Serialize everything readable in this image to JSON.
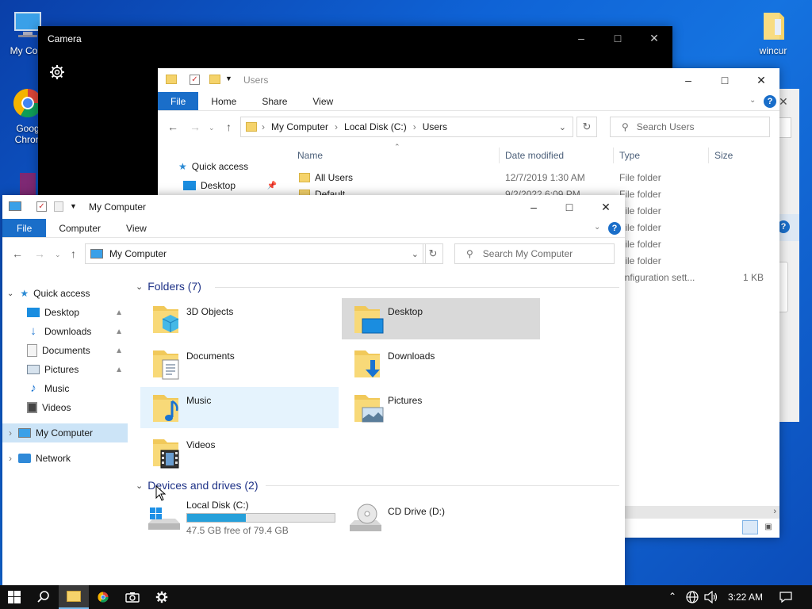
{
  "desktop": {
    "icons": [
      {
        "label": "My Com"
      },
      {
        "label": "Goog Chron"
      },
      {
        "label": "wincur"
      }
    ]
  },
  "camera": {
    "title": "Camera"
  },
  "users_window": {
    "quick_title": "Users",
    "tabs": [
      "File",
      "Home",
      "Share",
      "View"
    ],
    "breadcrumb": [
      "My Computer",
      "Local Disk (C:)",
      "Users"
    ],
    "search_placeholder": "Search Users",
    "columns": [
      "Name",
      "Date modified",
      "Type",
      "Size"
    ],
    "nav": [
      {
        "label": "Quick access"
      },
      {
        "label": "Desktop"
      }
    ],
    "rows": [
      {
        "name": "All Users",
        "date": "12/7/2019 1:30 AM",
        "type": "File folder",
        "size": ""
      },
      {
        "name": "Default",
        "date": "9/2/2022 6:09 PM",
        "type": "File folder",
        "size": ""
      },
      {
        "name": "",
        "date": "",
        "type": "File folder",
        "size": ""
      },
      {
        "name": "",
        "date": "",
        "type": "File folder",
        "size": ""
      },
      {
        "name": "",
        "date": "",
        "type": "File folder",
        "size": ""
      },
      {
        "name": "",
        "date": "",
        "type": "File folder",
        "size": ""
      },
      {
        "name": "",
        "date": "",
        "type": "onfiguration sett...",
        "size": "1 KB"
      }
    ]
  },
  "mycomp_window": {
    "title": "My Computer",
    "tabs": [
      "File",
      "Computer",
      "View"
    ],
    "address": "My Computer",
    "search_placeholder": "Search My Computer",
    "nav": [
      {
        "label": "Quick access"
      },
      {
        "label": "Desktop"
      },
      {
        "label": "Downloads"
      },
      {
        "label": "Documents"
      },
      {
        "label": "Pictures"
      },
      {
        "label": "Music"
      },
      {
        "label": "Videos"
      },
      {
        "label": "My Computer"
      },
      {
        "label": "Network"
      }
    ],
    "folders_header": "Folders (7)",
    "folders": [
      {
        "label": "3D Objects"
      },
      {
        "label": "Desktop"
      },
      {
        "label": "Documents"
      },
      {
        "label": "Downloads"
      },
      {
        "label": "Music"
      },
      {
        "label": "Pictures"
      },
      {
        "label": "Videos"
      }
    ],
    "devices_header": "Devices and drives (2)",
    "drives": [
      {
        "label": "Local Disk (C:)",
        "free_text": "47.5 GB free of 79.4 GB",
        "used_fraction": 0.4
      },
      {
        "label": "CD Drive (D:)"
      }
    ]
  },
  "taskbar": {
    "time": "3:22 AM"
  }
}
